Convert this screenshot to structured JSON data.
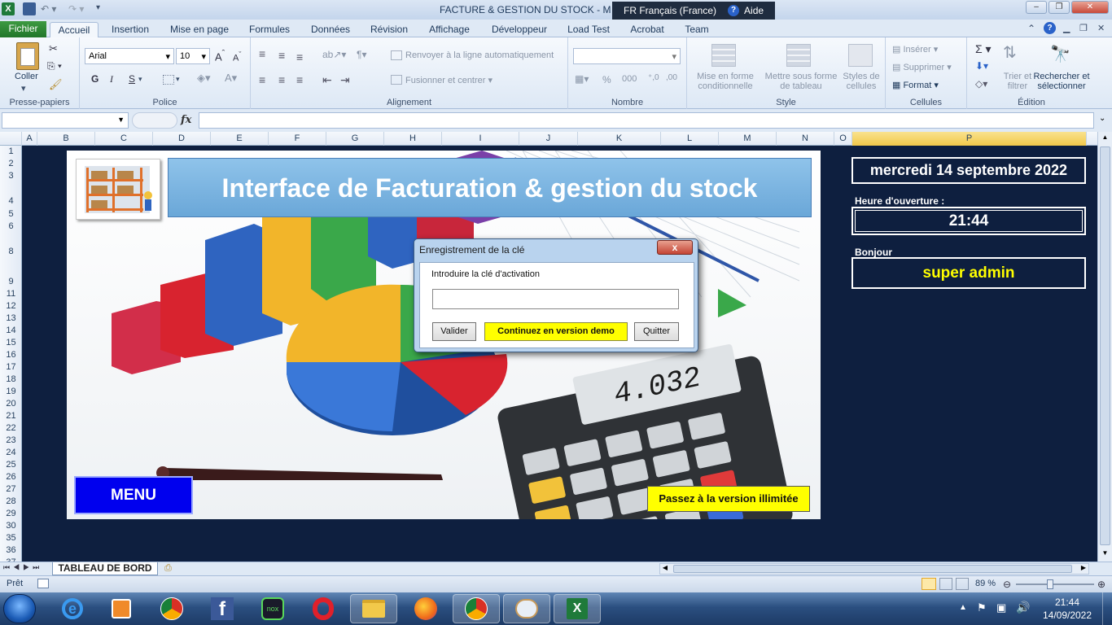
{
  "window": {
    "title": "FACTURE & GESTION DU STOCK - M",
    "language": "FR Français (France)",
    "help": "Aide"
  },
  "ribbon": {
    "tabs": [
      "Fichier",
      "Accueil",
      "Insertion",
      "Mise en page",
      "Formules",
      "Données",
      "Révision",
      "Affichage",
      "Développeur",
      "Load Test",
      "Acrobat",
      "Team"
    ],
    "clipboard": {
      "paste": "Coller",
      "group": "Presse-papiers"
    },
    "font": {
      "name": "Arial",
      "size": "10",
      "group": "Police",
      "bold": "G",
      "italic": "I",
      "underline": "S"
    },
    "alignment": {
      "wrap": "Renvoyer à la ligne automatiquement",
      "merge": "Fusionner et centrer",
      "group": "Alignement"
    },
    "number": {
      "group": "Nombre",
      "percent": "%",
      "thousands": "000"
    },
    "style": {
      "conditional": "Mise en forme conditionnelle",
      "table": "Mettre sous forme de tableau",
      "cell_styles": "Styles de cellules",
      "group": "Style"
    },
    "cells": {
      "insert": "Insérer",
      "delete": "Supprimer",
      "format": "Format",
      "group": "Cellules"
    },
    "editing": {
      "sort": "Trier et filtrer",
      "find": "Rechercher et sélectionner",
      "group": "Édition"
    }
  },
  "formula_bar": {
    "fx": "fx"
  },
  "columns": [
    "A",
    "B",
    "C",
    "D",
    "E",
    "F",
    "G",
    "H",
    "I",
    "J",
    "K",
    "L",
    "M",
    "N",
    "O",
    "P"
  ],
  "rows": [
    "1",
    "2",
    "3",
    "4",
    "5",
    "6",
    "8",
    "9",
    "11",
    "12",
    "13",
    "14",
    "15",
    "16",
    "17",
    "18",
    "19",
    "20",
    "21",
    "22",
    "23",
    "24",
    "25",
    "26",
    "27",
    "28",
    "29",
    "30",
    "35",
    "36",
    "37"
  ],
  "dashboard": {
    "banner": "Interface de Facturation & gestion du stock",
    "menu_button": "MENU",
    "upgrade_button": "Passez à la version illimitée",
    "calculator_display": "4.032",
    "date": "mercredi 14 septembre 2022",
    "opening_time_label": "Heure d'ouverture :",
    "opening_time": "21:44",
    "greeting_label": "Bonjour",
    "user": "super admin"
  },
  "dialog": {
    "title": "Enregistrement de la clé",
    "prompt": "Introduire la clé d'activation",
    "key_value": "",
    "validate": "Valider",
    "demo": "Continuez en version demo",
    "quit": "Quitter",
    "close": "x"
  },
  "sheets": {
    "active": "TABLEAU DE BORD"
  },
  "status": {
    "state": "Prêt",
    "zoom": "89 %"
  },
  "taskbar": {
    "time": "21:44",
    "date": "14/09/2022",
    "apps": [
      "internet-explorer",
      "media-player",
      "chrome",
      "facebook",
      "nox",
      "opera",
      "file-explorer",
      "firefox",
      "chrome-profile",
      "paint",
      "excel"
    ]
  },
  "colors": {
    "accent_blue": "#0000ee",
    "upgrade_yellow": "#ffff00",
    "sheet_background": "#0e1f3f",
    "highlight_demo": "#ffff00",
    "user_text": "#ffff00"
  }
}
